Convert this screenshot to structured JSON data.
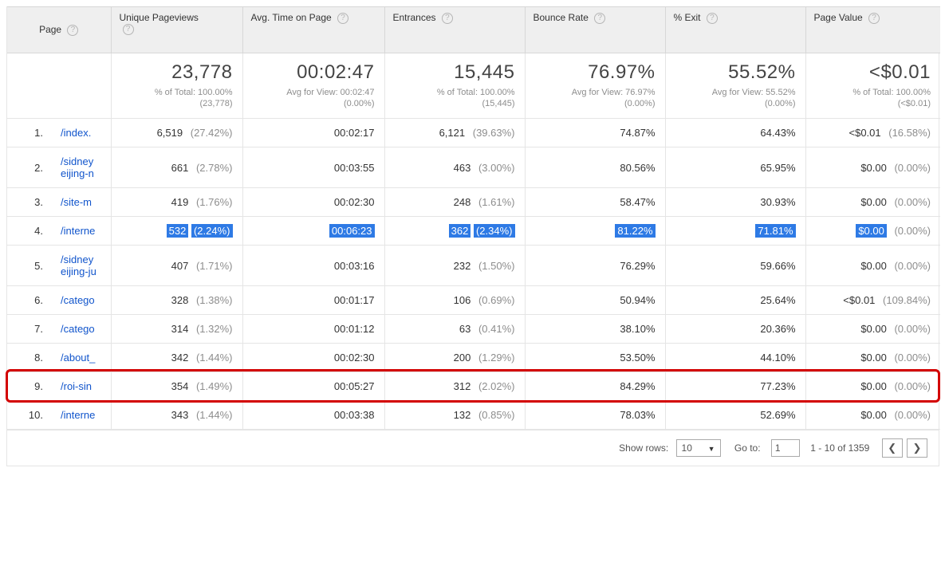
{
  "columns": {
    "page": "Page",
    "unique_pageviews": "Unique Pageviews",
    "avg_time": "Avg. Time on Page",
    "entrances": "Entrances",
    "bounce_rate": "Bounce Rate",
    "pct_exit": "% Exit",
    "page_value": "Page Value"
  },
  "summary": {
    "unique_pageviews": {
      "big": "23,778",
      "sub1": "% of Total: 100.00%",
      "sub2": "(23,778)"
    },
    "avg_time": {
      "big": "00:02:47",
      "sub1": "Avg for View: 00:02:47",
      "sub2": "(0.00%)"
    },
    "entrances": {
      "big": "15,445",
      "sub1": "% of Total: 100.00%",
      "sub2": "(15,445)"
    },
    "bounce_rate": {
      "big": "76.97%",
      "sub1": "Avg for View: 76.97%",
      "sub2": "(0.00%)"
    },
    "pct_exit": {
      "big": "55.52%",
      "sub1": "Avg for View: 55.52%",
      "sub2": "(0.00%)"
    },
    "page_value": {
      "big": "<$0.01",
      "sub1": "% of Total: 100.00%",
      "sub2": "(<$0.01)"
    }
  },
  "rows": [
    {
      "n": "1.",
      "page": "/index.",
      "pv": "6,519",
      "pv_pct": "(27.42%)",
      "time": "00:02:17",
      "ent": "6,121",
      "ent_pct": "(39.63%)",
      "bounce": "74.87%",
      "exit": "64.43%",
      "val": "<$0.01",
      "val_pct": "(16.58%)",
      "sel": false
    },
    {
      "n": "2.",
      "page": "/sidney eijing-n",
      "pv": "661",
      "pv_pct": "(2.78%)",
      "time": "00:03:55",
      "ent": "463",
      "ent_pct": "(3.00%)",
      "bounce": "80.56%",
      "exit": "65.95%",
      "val": "$0.00",
      "val_pct": "(0.00%)",
      "sel": false
    },
    {
      "n": "3.",
      "page": "/site-m",
      "pv": "419",
      "pv_pct": "(1.76%)",
      "time": "00:02:30",
      "ent": "248",
      "ent_pct": "(1.61%)",
      "bounce": "58.47%",
      "exit": "30.93%",
      "val": "$0.00",
      "val_pct": "(0.00%)",
      "sel": false
    },
    {
      "n": "4.",
      "page": "/interne",
      "pv": "532",
      "pv_pct": "(2.24%)",
      "time": "00:06:23",
      "ent": "362",
      "ent_pct": "(2.34%)",
      "bounce": "81.22%",
      "exit": "71.81%",
      "val": "$0.00",
      "val_pct": "(0.00%)",
      "sel": true
    },
    {
      "n": "5.",
      "page": "/sidney eijing-ju",
      "pv": "407",
      "pv_pct": "(1.71%)",
      "time": "00:03:16",
      "ent": "232",
      "ent_pct": "(1.50%)",
      "bounce": "76.29%",
      "exit": "59.66%",
      "val": "$0.00",
      "val_pct": "(0.00%)",
      "sel": false
    },
    {
      "n": "6.",
      "page": "/catego",
      "pv": "328",
      "pv_pct": "(1.38%)",
      "time": "00:01:17",
      "ent": "106",
      "ent_pct": "(0.69%)",
      "bounce": "50.94%",
      "exit": "25.64%",
      "val": "<$0.01",
      "val_pct": "(109.84%)",
      "sel": false
    },
    {
      "n": "7.",
      "page": "/catego",
      "pv": "314",
      "pv_pct": "(1.32%)",
      "time": "00:01:12",
      "ent": "63",
      "ent_pct": "(0.41%)",
      "bounce": "38.10%",
      "exit": "20.36%",
      "val": "$0.00",
      "val_pct": "(0.00%)",
      "sel": false
    },
    {
      "n": "8.",
      "page": "/about_",
      "pv": "342",
      "pv_pct": "(1.44%)",
      "time": "00:02:30",
      "ent": "200",
      "ent_pct": "(1.29%)",
      "bounce": "53.50%",
      "exit": "44.10%",
      "val": "$0.00",
      "val_pct": "(0.00%)",
      "sel": false
    },
    {
      "n": "9.",
      "page": "/roi-sin",
      "pv": "354",
      "pv_pct": "(1.49%)",
      "time": "00:05:27",
      "ent": "312",
      "ent_pct": "(2.02%)",
      "bounce": "84.29%",
      "exit": "77.23%",
      "val": "$0.00",
      "val_pct": "(0.00%)",
      "sel": false,
      "highlighted": true
    },
    {
      "n": "10.",
      "page": "/interne",
      "pv": "343",
      "pv_pct": "(1.44%)",
      "time": "00:03:38",
      "ent": "132",
      "ent_pct": "(0.85%)",
      "bounce": "78.03%",
      "exit": "52.69%",
      "val": "$0.00",
      "val_pct": "(0.00%)",
      "sel": false
    }
  ],
  "footer": {
    "show_rows_label": "Show rows:",
    "show_rows_value": "10",
    "goto_label": "Go to:",
    "goto_value": "1",
    "range": "1 - 10 of 1359"
  },
  "help_glyph": "?"
}
